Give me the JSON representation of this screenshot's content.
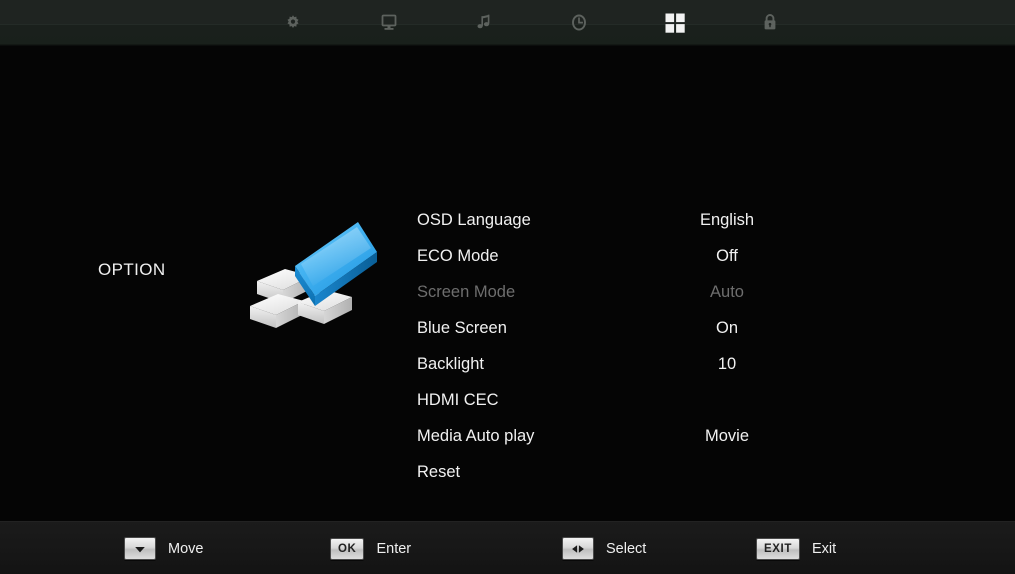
{
  "top_bar": {
    "tabs": [
      {
        "icon": "gear-icon",
        "name": "picture-settings-tab",
        "active": false
      },
      {
        "icon": "monitor-icon",
        "name": "display-tab",
        "active": false
      },
      {
        "icon": "music-note-icon",
        "name": "sound-tab",
        "active": false
      },
      {
        "icon": "clock-icon",
        "name": "time-tab",
        "active": false
      },
      {
        "icon": "grid-icon",
        "name": "option-tab",
        "active": true
      },
      {
        "icon": "lock-icon",
        "name": "lock-tab",
        "active": false
      }
    ]
  },
  "menu": {
    "category": "OPTION",
    "graphic": "3d-blocks-icon",
    "accent_color": "#3ab0f0",
    "options": [
      {
        "label": "OSD Language",
        "value": "English",
        "disabled": false
      },
      {
        "label": "ECO Mode",
        "value": "Off",
        "disabled": false
      },
      {
        "label": "Screen Mode",
        "value": "Auto",
        "disabled": true
      },
      {
        "label": "Blue Screen",
        "value": "On",
        "disabled": false
      },
      {
        "label": "Backlight",
        "value": "10",
        "disabled": false
      },
      {
        "label": "HDMI CEC",
        "value": "",
        "disabled": false
      },
      {
        "label": "Media Auto play",
        "value": "Movie",
        "disabled": false
      },
      {
        "label": "Reset",
        "value": "",
        "disabled": false
      }
    ]
  },
  "help_bar": {
    "items": [
      {
        "key": "",
        "icon": "arrow-down-icon",
        "label": "Move"
      },
      {
        "key": "OK",
        "icon": "",
        "label": "Enter"
      },
      {
        "key": "",
        "icon": "arrow-left-right-icon",
        "label": "Select"
      },
      {
        "key": "EXIT",
        "icon": "",
        "label": "Exit"
      }
    ]
  }
}
